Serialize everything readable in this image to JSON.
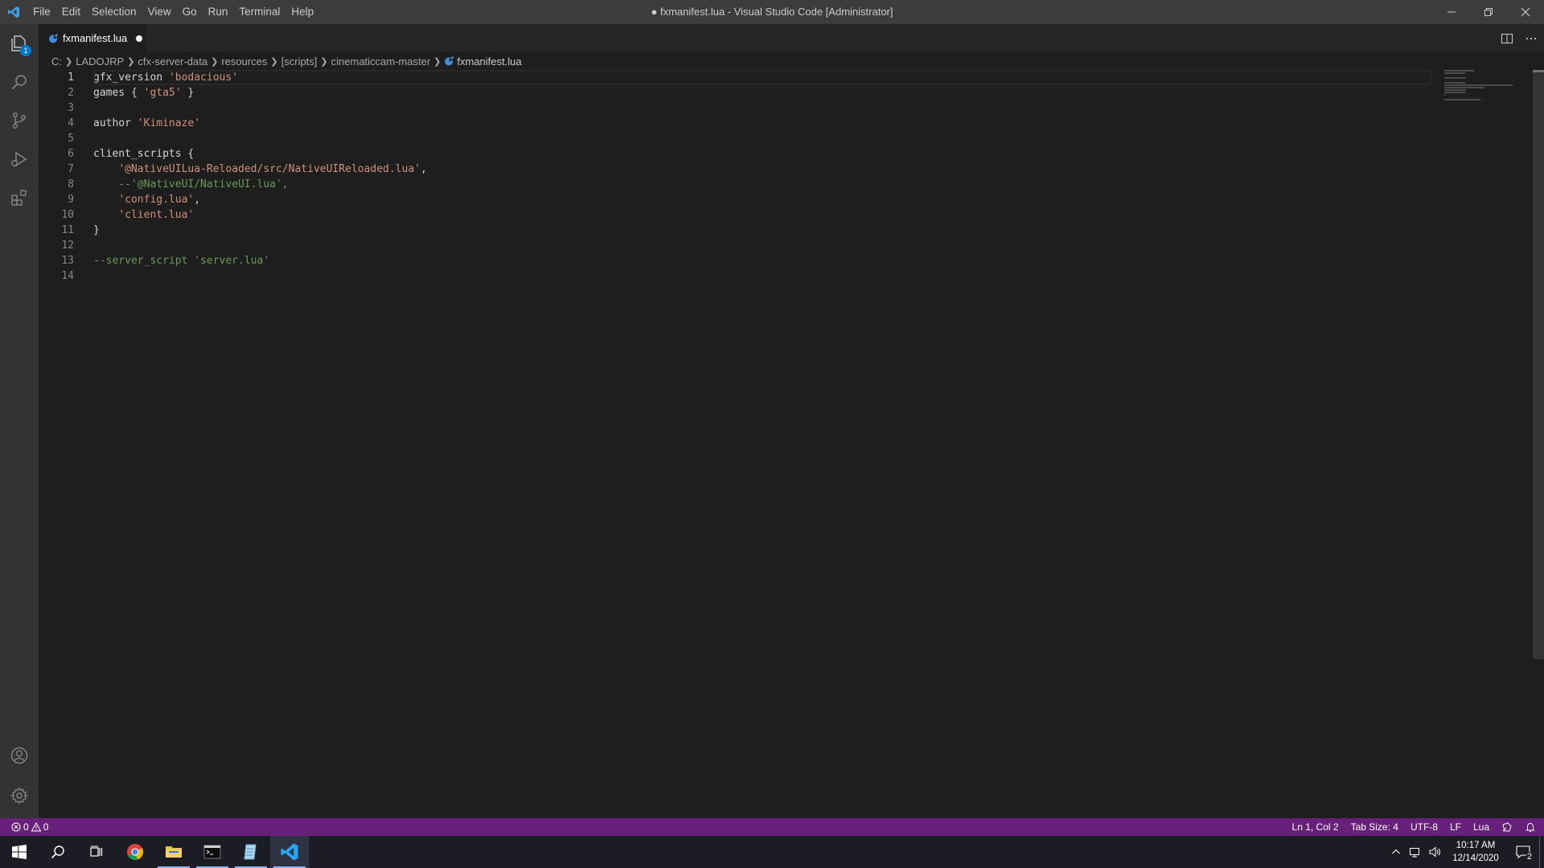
{
  "titlebar": {
    "menu": [
      "File",
      "Edit",
      "Selection",
      "View",
      "Go",
      "Run",
      "Terminal",
      "Help"
    ],
    "title": "● fxmanifest.lua - Visual Studio Code [Administrator]"
  },
  "activitybar": {
    "explorer_badge": "1",
    "items": [
      "files-icon",
      "search-icon",
      "source-control-icon",
      "run-debug-icon",
      "extensions-icon"
    ],
    "bottom": [
      "account-icon",
      "settings-gear-icon"
    ]
  },
  "tab": {
    "label": "fxmanifest.lua",
    "dirty": true,
    "icon": "lua-file-icon"
  },
  "breadcrumb": [
    "C:",
    "LADOJRP",
    "cfx-server-data",
    "resources",
    "[scripts]",
    "cinematiccam-master"
  ],
  "breadcrumb_file": "fxmanifest.lua",
  "editor": {
    "line_numbers": [
      "1",
      "2",
      "3",
      "4",
      "5",
      "6",
      "7",
      "8",
      "9",
      "10",
      "11",
      "12",
      "13",
      "14"
    ],
    "active_line": 1,
    "lines": [
      [
        {
          "t": "plain",
          "v": "gfx_version "
        },
        {
          "t": "str",
          "v": "'bodacious'"
        }
      ],
      [
        {
          "t": "plain",
          "v": "games { "
        },
        {
          "t": "str",
          "v": "'gta5'"
        },
        {
          "t": "plain",
          "v": " }"
        }
      ],
      [],
      [
        {
          "t": "plain",
          "v": "author "
        },
        {
          "t": "str",
          "v": "'Kiminaze'"
        }
      ],
      [],
      [
        {
          "t": "plain",
          "v": "client_scripts {"
        }
      ],
      [
        {
          "t": "plain",
          "v": "    "
        },
        {
          "t": "str",
          "v": "'@NativeUILua-Reloaded/src/NativeUIReloaded.lua'"
        },
        {
          "t": "plain",
          "v": ","
        }
      ],
      [
        {
          "t": "plain",
          "v": "    "
        },
        {
          "t": "cmt",
          "v": "--'@NativeUI/NativeUI.lua',"
        }
      ],
      [
        {
          "t": "plain",
          "v": "    "
        },
        {
          "t": "str",
          "v": "'config.lua'"
        },
        {
          "t": "plain",
          "v": ","
        }
      ],
      [
        {
          "t": "plain",
          "v": "    "
        },
        {
          "t": "str",
          "v": "'client.lua'"
        }
      ],
      [
        {
          "t": "plain",
          "v": "}"
        }
      ],
      [],
      [
        {
          "t": "cmt",
          "v": "--server_script 'server.lua'"
        }
      ],
      []
    ]
  },
  "statusbar": {
    "errors": "0",
    "warnings": "0",
    "position": "Ln 1, Col 2",
    "tab_size": "Tab Size: 4",
    "encoding": "UTF-8",
    "eol": "LF",
    "language": "Lua"
  },
  "taskbar": {
    "apps": [
      "start-icon",
      "search-icon",
      "task-view-icon",
      "chrome-icon",
      "file-explorer-icon",
      "terminal-icon",
      "notepad-icon",
      "vscode-icon"
    ],
    "time": "10:17 AM",
    "date": "12/14/2020",
    "notification_count": "2"
  },
  "colors": {
    "statusbar": "#68217a",
    "titlebar": "#3c3c3c",
    "activitybar": "#333333",
    "editor_bg": "#1e1e1e",
    "string": "#ce9178",
    "comment": "#6a9955"
  }
}
